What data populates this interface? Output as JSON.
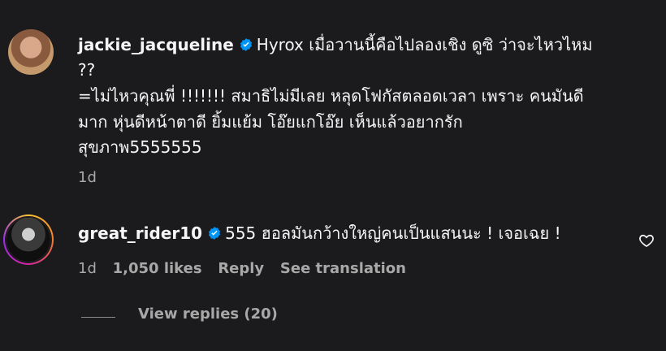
{
  "comments": [
    {
      "username": "jackie_jacqueline",
      "verified": true,
      "text_lines": [
        "Hyrox เมื่อวานนี้คือไปลองเชิง ดูซิ ว่าจะไหวไหม",
        "??",
        "=ไม่ไหวคุณพี่ !!!!!!! สมาธิไม่มีเลย หลุดโฟกัสตลอดเวลา เพราะ คนมันดี",
        "มาก หุ่นดีหน้าตาดี ยิ้มแย้ม โอ๊ยแกโอ๊ย เห็นแล้วอยากรัก",
        "สุขภาพ5555555"
      ],
      "time": "1d"
    },
    {
      "username": "great_rider10",
      "verified": true,
      "text": "555 ฮอลมันกว้างใหญ่คนเป็นแสนนะ ! เจอเฉย !",
      "time": "1d",
      "likes": "1,050 likes",
      "reply_label": "Reply",
      "translate_label": "See translation",
      "view_replies": "View replies (20)"
    }
  ],
  "colors": {
    "background": "#1b1b1d",
    "text": "#f5f5f5",
    "secondary": "#a8a8a8",
    "verified": "#0095f6"
  }
}
